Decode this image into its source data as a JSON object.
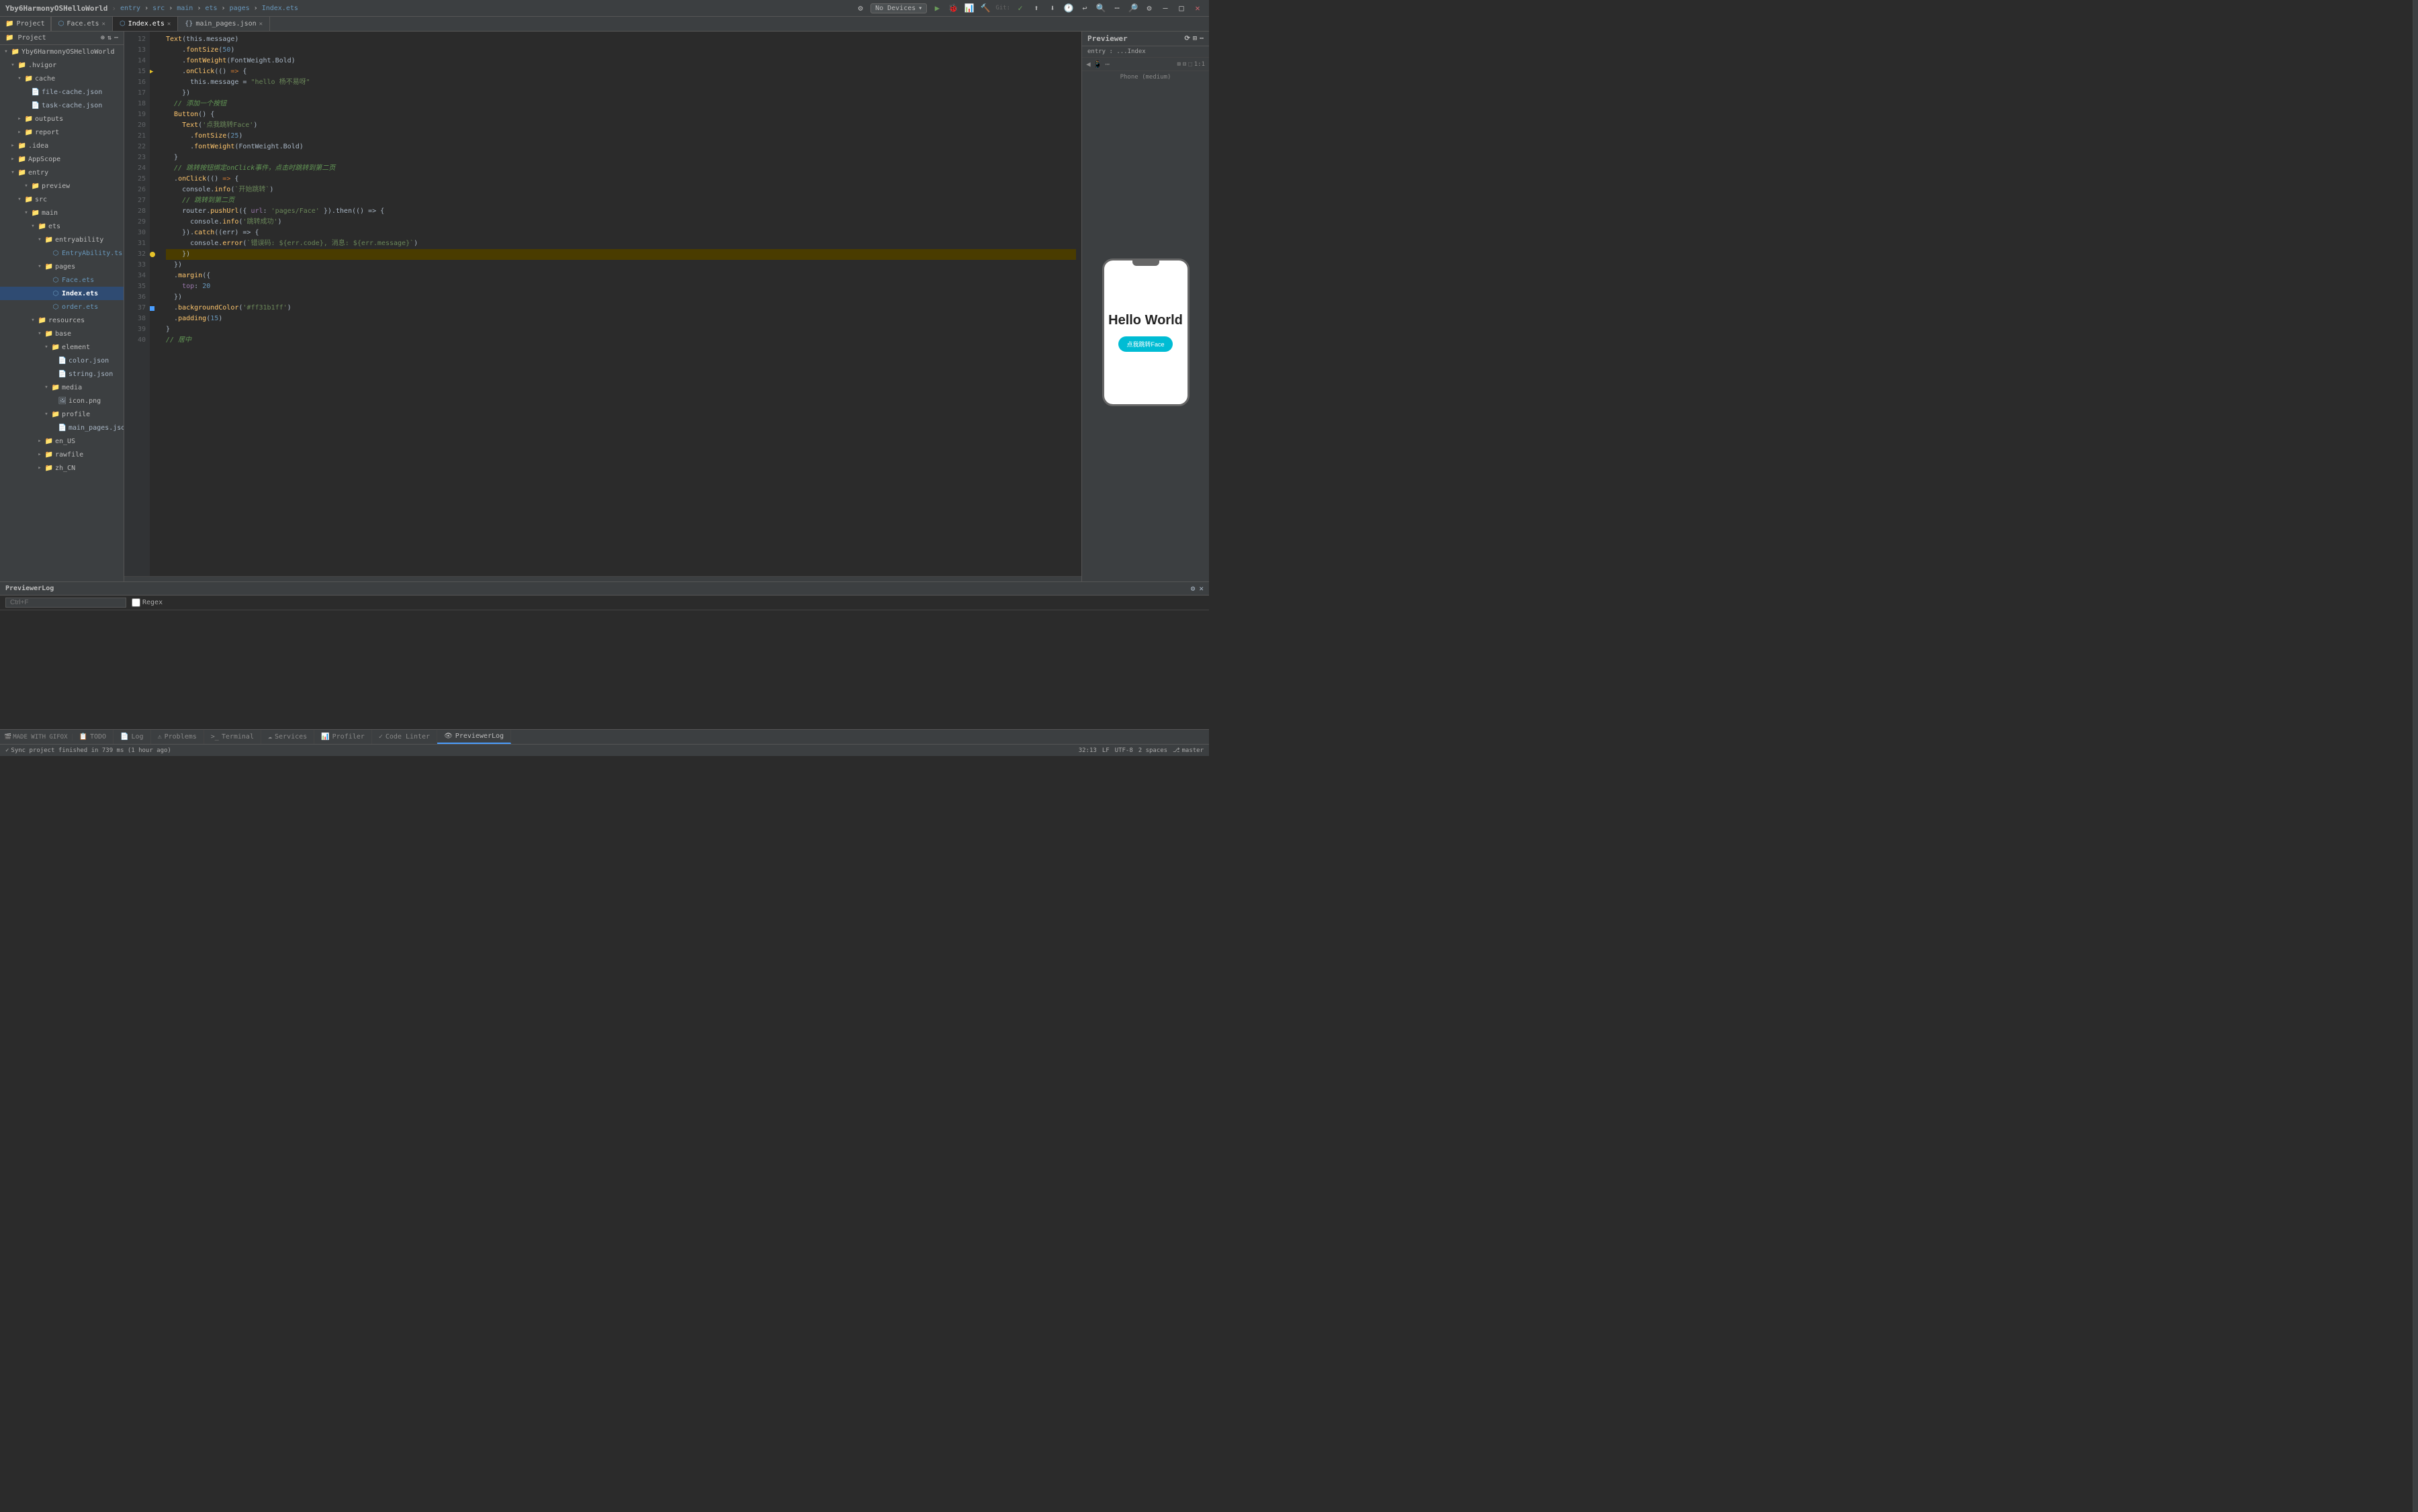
{
  "topbar": {
    "title": "Yby6HarmonyOSHelloWorld",
    "breadcrumbs": [
      "entry",
      "src",
      "main",
      "ets",
      "pages",
      "Index.ets"
    ],
    "active_file": "Index.ets",
    "device": "No Devices",
    "git_branch": "master"
  },
  "tabs": [
    {
      "id": "face-ets",
      "label": "Face.ets",
      "active": false,
      "closable": true
    },
    {
      "id": "index-ets",
      "label": "Index.ets",
      "active": true,
      "closable": true
    },
    {
      "id": "main-pages-json",
      "label": "main_pages.json",
      "active": false,
      "closable": true
    }
  ],
  "sidebar": {
    "project_label": "Project",
    "root": "Yby6HarmonyOSHelloWorld",
    "tree": [
      {
        "id": "hvigor",
        "label": ".hvigor",
        "type": "folder",
        "depth": 1,
        "open": true
      },
      {
        "id": "cache",
        "label": "cache",
        "type": "folder",
        "depth": 2,
        "open": true
      },
      {
        "id": "file-cache",
        "label": "file-cache.json",
        "type": "json",
        "depth": 3
      },
      {
        "id": "task-cache",
        "label": "task-cache.json",
        "type": "json",
        "depth": 3
      },
      {
        "id": "outputs",
        "label": "outputs",
        "type": "folder",
        "depth": 2
      },
      {
        "id": "report",
        "label": "report",
        "type": "folder",
        "depth": 2
      },
      {
        "id": "idea",
        "label": ".idea",
        "type": "folder",
        "depth": 1
      },
      {
        "id": "appscope",
        "label": "AppScope",
        "type": "folder",
        "depth": 1
      },
      {
        "id": "entry",
        "label": "entry",
        "type": "folder",
        "depth": 1,
        "open": true
      },
      {
        "id": "preview",
        "label": "preview",
        "type": "folder",
        "depth": 3
      },
      {
        "id": "src",
        "label": "src",
        "type": "folder",
        "depth": 2,
        "open": true
      },
      {
        "id": "main",
        "label": "main",
        "type": "folder",
        "depth": 3,
        "open": true
      },
      {
        "id": "ets",
        "label": "ets",
        "type": "folder",
        "depth": 4,
        "open": true
      },
      {
        "id": "entryability",
        "label": "entryability",
        "type": "folder",
        "depth": 5,
        "open": true
      },
      {
        "id": "entryability-ts",
        "label": "EntryAbility.ts",
        "type": "ts",
        "depth": 6
      },
      {
        "id": "pages",
        "label": "pages",
        "type": "folder",
        "depth": 5,
        "open": true
      },
      {
        "id": "face-ets-tree",
        "label": "Face.ets",
        "type": "ets",
        "depth": 6
      },
      {
        "id": "index-ets-tree",
        "label": "Index.ets",
        "type": "ets",
        "depth": 6,
        "selected": true
      },
      {
        "id": "order-ets-tree",
        "label": "order.ets",
        "type": "ets",
        "depth": 6
      },
      {
        "id": "resources",
        "label": "resources",
        "type": "folder",
        "depth": 4,
        "open": true
      },
      {
        "id": "base",
        "label": "base",
        "type": "folder",
        "depth": 5,
        "open": true
      },
      {
        "id": "element",
        "label": "element",
        "type": "folder",
        "depth": 6,
        "open": true
      },
      {
        "id": "color-json",
        "label": "color.json",
        "type": "json",
        "depth": 7
      },
      {
        "id": "string-json",
        "label": "string.json",
        "type": "json",
        "depth": 7
      },
      {
        "id": "media",
        "label": "media",
        "type": "folder",
        "depth": 6,
        "open": true
      },
      {
        "id": "icon-png",
        "label": "icon.png",
        "type": "png",
        "depth": 7
      },
      {
        "id": "profile",
        "label": "profile",
        "type": "folder",
        "depth": 6,
        "open": true
      },
      {
        "id": "main-pages-json-tree",
        "label": "main_pages.json",
        "type": "json",
        "depth": 7
      },
      {
        "id": "en-us",
        "label": "en_US",
        "type": "folder",
        "depth": 5
      },
      {
        "id": "rawfile",
        "label": "rawfile",
        "type": "folder",
        "depth": 5
      },
      {
        "id": "zh-cn",
        "label": "zh_CN",
        "type": "folder",
        "depth": 5
      }
    ]
  },
  "editor": {
    "lines": [
      {
        "num": 12,
        "content": "  Text(this.message)",
        "tokens": [
          {
            "t": "fn",
            "v": "Text"
          },
          {
            "t": "paren",
            "v": "("
          },
          {
            "t": "var",
            "v": "this.message"
          },
          {
            "t": "paren",
            "v": ")"
          }
        ]
      },
      {
        "num": 13,
        "content": "    .fontSize(50)",
        "tokens": [
          {
            "t": "dot",
            "v": "."
          },
          {
            "t": "method",
            "v": "fontSize"
          },
          {
            "t": "paren",
            "v": "("
          },
          {
            "t": "num",
            "v": "50"
          },
          {
            "t": "paren",
            "v": ")"
          }
        ]
      },
      {
        "num": 14,
        "content": "    .fontWeight(FontWeight.Bold)",
        "tokens": [
          {
            "t": "dot",
            "v": "."
          },
          {
            "t": "method",
            "v": "fontWeight"
          },
          {
            "t": "paren",
            "v": "("
          },
          {
            "t": "var",
            "v": "FontWeight.Bold"
          },
          {
            "t": "paren",
            "v": ")"
          }
        ]
      },
      {
        "num": 15,
        "content": "    .onClick(() => {",
        "tokens": [
          {
            "t": "dot",
            "v": "."
          },
          {
            "t": "method",
            "v": "onClick"
          },
          {
            "t": "paren",
            "v": "(()"
          },
          {
            "t": "kw",
            "v": " => "
          },
          {
            "t": "paren",
            "v": "{"
          }
        ]
      },
      {
        "num": 16,
        "content": "      this.message = \"hello 杨不易呀\"",
        "tokens": [
          {
            "t": "var",
            "v": "      this.message"
          },
          {
            "t": "var",
            "v": " = "
          },
          {
            "t": "str",
            "v": "\"hello 杨不易呀\""
          }
        ]
      },
      {
        "num": 17,
        "content": "    })",
        "tokens": [
          {
            "t": "paren",
            "v": "    })"
          }
        ]
      },
      {
        "num": 18,
        "content": "  // 添加一个按钮",
        "tokens": [
          {
            "t": "cmt",
            "v": "  // 添加一个按钮"
          }
        ]
      },
      {
        "num": 19,
        "content": "  Button() {",
        "tokens": [
          {
            "t": "fn",
            "v": "  Button"
          },
          {
            "t": "paren",
            "v": "() {"
          }
        ]
      },
      {
        "num": 20,
        "content": "    Text('点我跳转Face')",
        "tokens": [
          {
            "t": "fn",
            "v": "    Text"
          },
          {
            "t": "paren",
            "v": "("
          },
          {
            "t": "str",
            "v": "'点我跳转Face'"
          },
          {
            "t": "paren",
            "v": ")"
          }
        ]
      },
      {
        "num": 21,
        "content": "      .fontSize(25)",
        "tokens": [
          {
            "t": "dot",
            "v": "."
          },
          {
            "t": "method",
            "v": "fontSize"
          },
          {
            "t": "paren",
            "v": "("
          },
          {
            "t": "num",
            "v": "25"
          },
          {
            "t": "paren",
            "v": ")"
          }
        ]
      },
      {
        "num": 22,
        "content": "      .fontWeight(FontWeight.Bold)",
        "tokens": [
          {
            "t": "dot",
            "v": "."
          },
          {
            "t": "method",
            "v": "fontWeight"
          },
          {
            "t": "paren",
            "v": "("
          },
          {
            "t": "var",
            "v": "FontWeight.Bold"
          },
          {
            "t": "paren",
            "v": ")"
          }
        ]
      },
      {
        "num": 23,
        "content": "  }",
        "tokens": [
          {
            "t": "paren",
            "v": "  }"
          }
        ]
      },
      {
        "num": 24,
        "content": "  // 跳转按钮绑定onClick事件，点击时跳转到第二页",
        "tokens": [
          {
            "t": "cmt",
            "v": "  // 跳转按钮绑定onClick事件，点击时跳转到第二页"
          }
        ]
      },
      {
        "num": 25,
        "content": "  .onClick(() => {",
        "tokens": [
          {
            "t": "dot",
            "v": "  ."
          },
          {
            "t": "method",
            "v": "onClick"
          },
          {
            "t": "paren",
            "v": "(()"
          },
          {
            "t": "kw",
            "v": " => "
          },
          {
            "t": "paren",
            "v": "{"
          }
        ]
      },
      {
        "num": 26,
        "content": "    console.info(`开始跳转`)",
        "tokens": [
          {
            "t": "var",
            "v": "    console."
          },
          {
            "t": "method",
            "v": "info"
          },
          {
            "t": "paren",
            "v": "("
          },
          {
            "t": "str",
            "v": "`开始跳转`"
          },
          {
            "t": "paren",
            "v": ")"
          }
        ]
      },
      {
        "num": 27,
        "content": "    // 跳转到第二页",
        "tokens": [
          {
            "t": "cmt",
            "v": "    // 跳转到第二页"
          }
        ]
      },
      {
        "num": 28,
        "content": "    router.pushUrl({ url: 'pages/Face' }).then(() => {",
        "tokens": [
          {
            "t": "var",
            "v": "    router."
          },
          {
            "t": "method",
            "v": "pushUrl"
          },
          {
            "t": "paren",
            "v": "({ "
          },
          {
            "t": "prop",
            "v": "url"
          },
          {
            "t": "paren",
            "v": ": "
          },
          {
            "t": "str",
            "v": "'pages/Face'"
          },
          {
            "t": "paren",
            "v": " }).then(() => {"
          }
        ]
      },
      {
        "num": 29,
        "content": "      console.info('跳转成功')",
        "tokens": [
          {
            "t": "var",
            "v": "      console."
          },
          {
            "t": "method",
            "v": "info"
          },
          {
            "t": "paren",
            "v": "("
          },
          {
            "t": "str",
            "v": "'跳转成功'"
          },
          {
            "t": "paren",
            "v": ")"
          }
        ]
      },
      {
        "num": 30,
        "content": "    }).catch((err) => {",
        "tokens": [
          {
            "t": "paren",
            "v": "    })."
          },
          {
            "t": "method",
            "v": "catch"
          },
          {
            "t": "paren",
            "v": "((err) => {"
          }
        ]
      },
      {
        "num": 31,
        "content": "      console.error(`错误码: ${err.code}, 消息: ${err.message}`)",
        "tokens": [
          {
            "t": "var",
            "v": "      console."
          },
          {
            "t": "method",
            "v": "error"
          },
          {
            "t": "paren",
            "v": "("
          },
          {
            "t": "str",
            "v": "`错误码: ${err.code}, 消息: ${err.message}`"
          },
          {
            "t": "paren",
            "v": ")"
          }
        ]
      },
      {
        "num": 32,
        "content": "    })",
        "tokens": [
          {
            "t": "paren",
            "v": "    })"
          }
        ],
        "debug": true
      },
      {
        "num": 33,
        "content": "  })",
        "tokens": [
          {
            "t": "paren",
            "v": "  })"
          }
        ]
      },
      {
        "num": 34,
        "content": "  .margin({",
        "tokens": [
          {
            "t": "dot",
            "v": "  ."
          },
          {
            "t": "method",
            "v": "margin"
          },
          {
            "t": "paren",
            "v": "({"
          }
        ]
      },
      {
        "num": 35,
        "content": "    top: 20",
        "tokens": [
          {
            "t": "prop",
            "v": "    top"
          },
          {
            "t": "var",
            "v": ": "
          },
          {
            "t": "num",
            "v": "20"
          }
        ]
      },
      {
        "num": 36,
        "content": "  })",
        "tokens": [
          {
            "t": "paren",
            "v": "  })"
          }
        ]
      },
      {
        "num": 37,
        "content": "  .backgroundColor('#ff31b1ff')",
        "tokens": [
          {
            "t": "dot",
            "v": "  ."
          },
          {
            "t": "method",
            "v": "backgroundColor"
          },
          {
            "t": "paren",
            "v": "("
          },
          {
            "t": "str",
            "v": "'#ff31b1ff'"
          },
          {
            "t": "paren",
            "v": ")"
          }
        ],
        "blue_sq": true
      },
      {
        "num": 38,
        "content": "  .padding(15)",
        "tokens": [
          {
            "t": "dot",
            "v": "  ."
          },
          {
            "t": "method",
            "v": "padding"
          },
          {
            "t": "paren",
            "v": "("
          },
          {
            "t": "num",
            "v": "15"
          },
          {
            "t": "paren",
            "v": ")"
          }
        ]
      },
      {
        "num": 39,
        "content": "}",
        "tokens": [
          {
            "t": "paren",
            "v": "}"
          }
        ]
      },
      {
        "num": 40,
        "content": "// 居中",
        "tokens": [
          {
            "t": "cmt",
            "v": "// 居中"
          }
        ]
      }
    ]
  },
  "previewer": {
    "title": "Previewer",
    "path": "entry : ...Index",
    "phone_type": "Phone (medium)",
    "hello_text": "Hello World",
    "btn_text": "点我跳转Face"
  },
  "log": {
    "title": "PreviewerLog",
    "search_placeholder": "Ctrl+F",
    "regex_label": "Regex"
  },
  "bottom_tabs": [
    {
      "id": "todo",
      "label": "TODO",
      "icon": "📋"
    },
    {
      "id": "log",
      "label": "Log",
      "icon": "📄"
    },
    {
      "id": "problems",
      "label": "Problems",
      "icon": "⚠"
    },
    {
      "id": "terminal",
      "label": "Terminal",
      "icon": ">_"
    },
    {
      "id": "services",
      "label": "Services",
      "icon": "☁"
    },
    {
      "id": "profiler",
      "label": "Profiler",
      "icon": "📊"
    },
    {
      "id": "codelinter",
      "label": "Code Linter",
      "icon": "✓"
    },
    {
      "id": "previewerlog",
      "label": "PreviewerLog",
      "icon": "👁",
      "active": true
    }
  ],
  "status_bar": {
    "made_with": "MADE WITH GIFOX",
    "sync_msg": "Sync project finished in 739 ms (1 hour ago)",
    "position": "32:13",
    "encoding": "UTF-8",
    "indent": "2 spaces",
    "lf": "LF",
    "branch": "master"
  }
}
